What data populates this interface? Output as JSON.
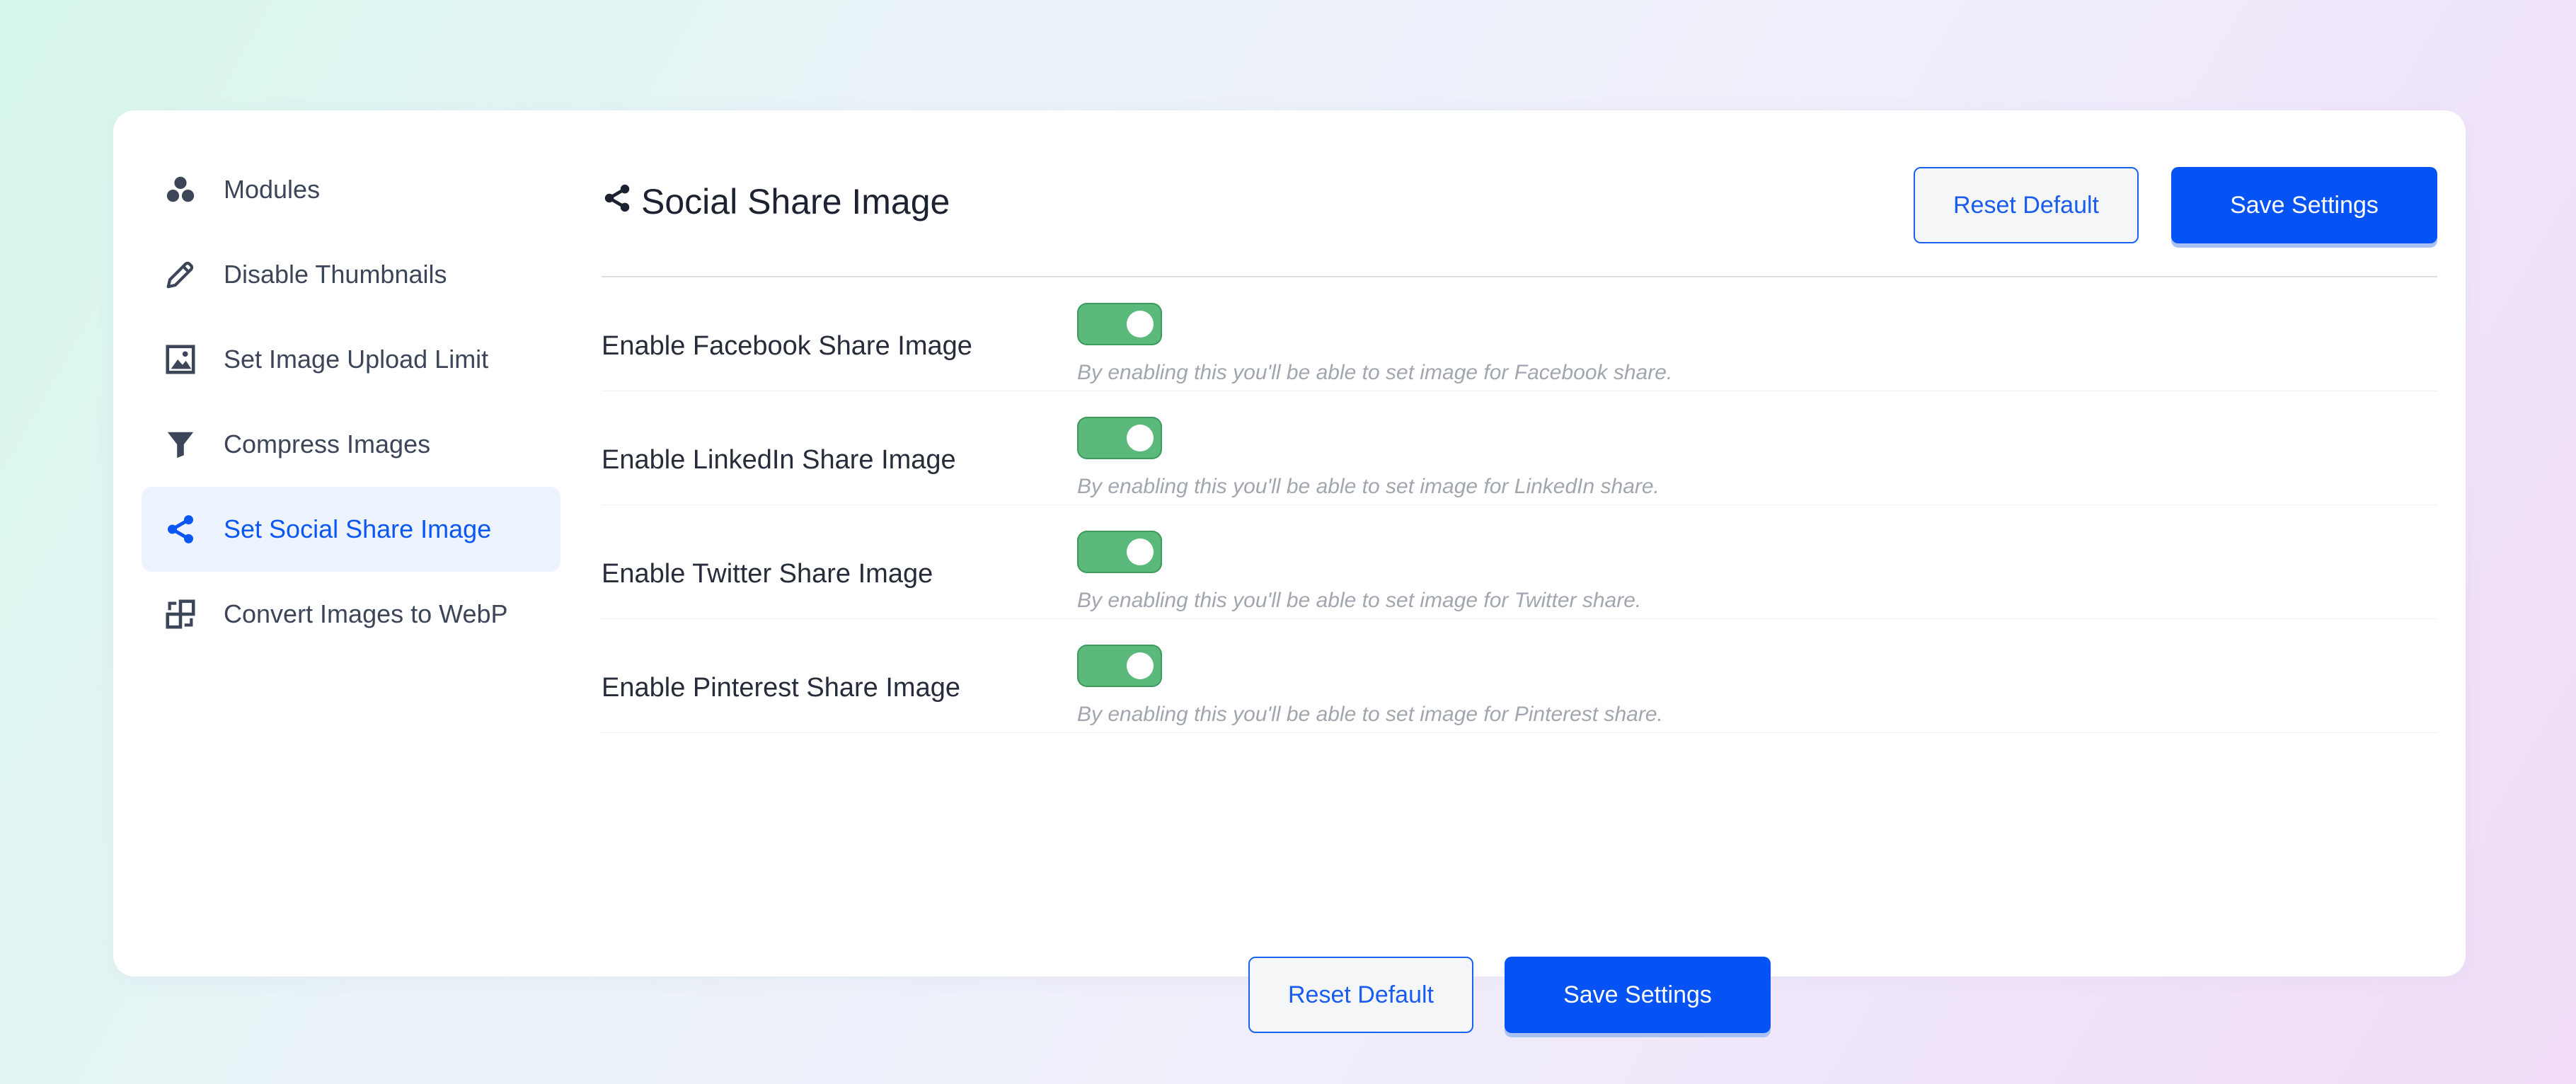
{
  "sidebar": {
    "items": [
      {
        "label": "Modules",
        "icon": "modules-icon",
        "active": false
      },
      {
        "label": "Disable Thumbnails",
        "icon": "pencil-icon",
        "active": false
      },
      {
        "label": "Set Image Upload Limit",
        "icon": "image-icon",
        "active": false
      },
      {
        "label": "Compress Images",
        "icon": "funnel-icon",
        "active": false
      },
      {
        "label": "Set Social Share Image",
        "icon": "share-icon",
        "active": true
      },
      {
        "label": "Convert Images to WebP",
        "icon": "convert-icon",
        "active": false
      }
    ]
  },
  "header": {
    "title": "Social Share Image",
    "title_icon": "share-icon",
    "reset_label": "Reset Default",
    "save_label": "Save Settings"
  },
  "settings": [
    {
      "label": "Enable Facebook Share Image",
      "enabled": true,
      "description": "By enabling this you'll be able to set image for Facebook share."
    },
    {
      "label": "Enable LinkedIn Share Image",
      "enabled": true,
      "description": "By enabling this you'll be able to set image for LinkedIn share."
    },
    {
      "label": "Enable Twitter Share Image",
      "enabled": true,
      "description": "By enabling this you'll be able to set image for Twitter share."
    },
    {
      "label": "Enable Pinterest Share Image",
      "enabled": true,
      "description": "By enabling this you'll be able to set image for Pinterest share."
    }
  ],
  "footer": {
    "reset_label": "Reset Default",
    "save_label": "Save Settings"
  },
  "colors": {
    "accent": "#0653f5",
    "toggle_on": "#5bb97b",
    "active_bg": "#eef4ff"
  }
}
